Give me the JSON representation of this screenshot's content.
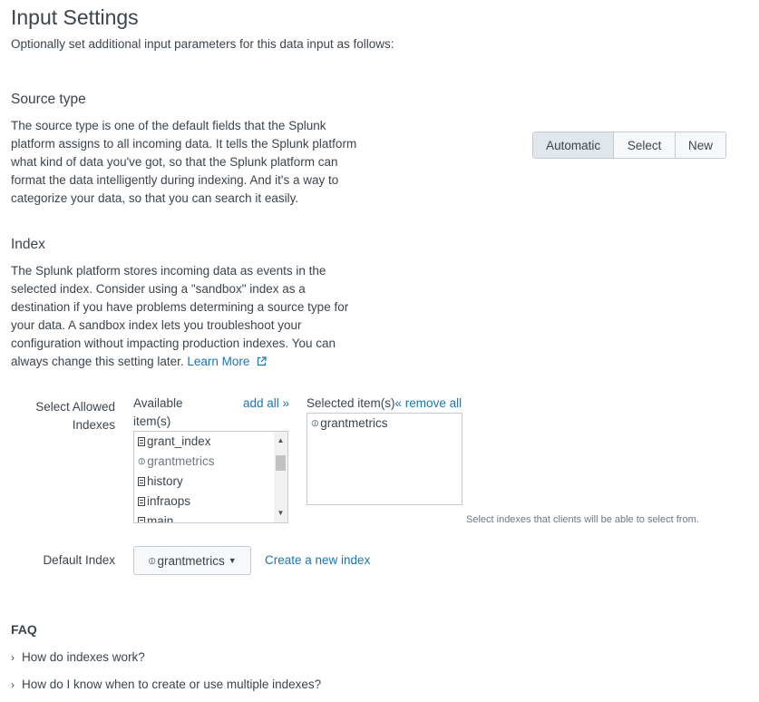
{
  "header": {
    "title": "Input Settings",
    "subtitle": "Optionally set additional input parameters for this data input as follows:"
  },
  "source_type": {
    "title": "Source type",
    "description_lines": [
      "The source type is one of the default fields that the Splunk",
      "platform assigns to all incoming data. It tells the Splunk platform",
      "what kind of data you've got, so that the Splunk platform can",
      "format the data intelligently during indexing. And it's a way to",
      "categorize your data, so that you can search it easily."
    ],
    "options": [
      "Automatic",
      "Select",
      "New"
    ],
    "selected": "Automatic"
  },
  "index": {
    "title": "Index",
    "description_lines": [
      "The Splunk platform stores incoming data as events in the",
      "selected index. Consider using a \"sandbox\" index as a",
      "destination if you have problems determining a source type for",
      "your data. A sandbox index lets you troubleshoot your",
      "configuration without impacting production indexes. You can"
    ],
    "description_last": "always change this setting later.",
    "learn_more": "Learn More"
  },
  "allowed_indexes": {
    "label_line1": "Select Allowed",
    "label_line2": "Indexes",
    "available_label_line1": "Available",
    "available_label_line2": "item(s)",
    "add_all": "add all »",
    "selected_label": "Selected item(s)",
    "remove_all": "« remove all",
    "available": [
      {
        "name": "grant_index",
        "icon": "database-icon",
        "dim": false
      },
      {
        "name": "grantmetrics",
        "icon": "tag-icon",
        "dim": true
      },
      {
        "name": "history",
        "icon": "database-icon",
        "dim": false
      },
      {
        "name": "infraops",
        "icon": "database-icon",
        "dim": false
      },
      {
        "name": "main",
        "icon": "database-icon",
        "dim": false
      }
    ],
    "selected": [
      {
        "name": "grantmetrics",
        "icon": "tag-icon"
      }
    ],
    "hint": "Select indexes that clients will be able to select from."
  },
  "default_index": {
    "label": "Default Index",
    "value": "grantmetrics",
    "create_link": "Create a new index"
  },
  "faq": {
    "title": "FAQ",
    "items": [
      "How do indexes work?",
      "How do I know when to create or use multiple indexes?"
    ]
  }
}
